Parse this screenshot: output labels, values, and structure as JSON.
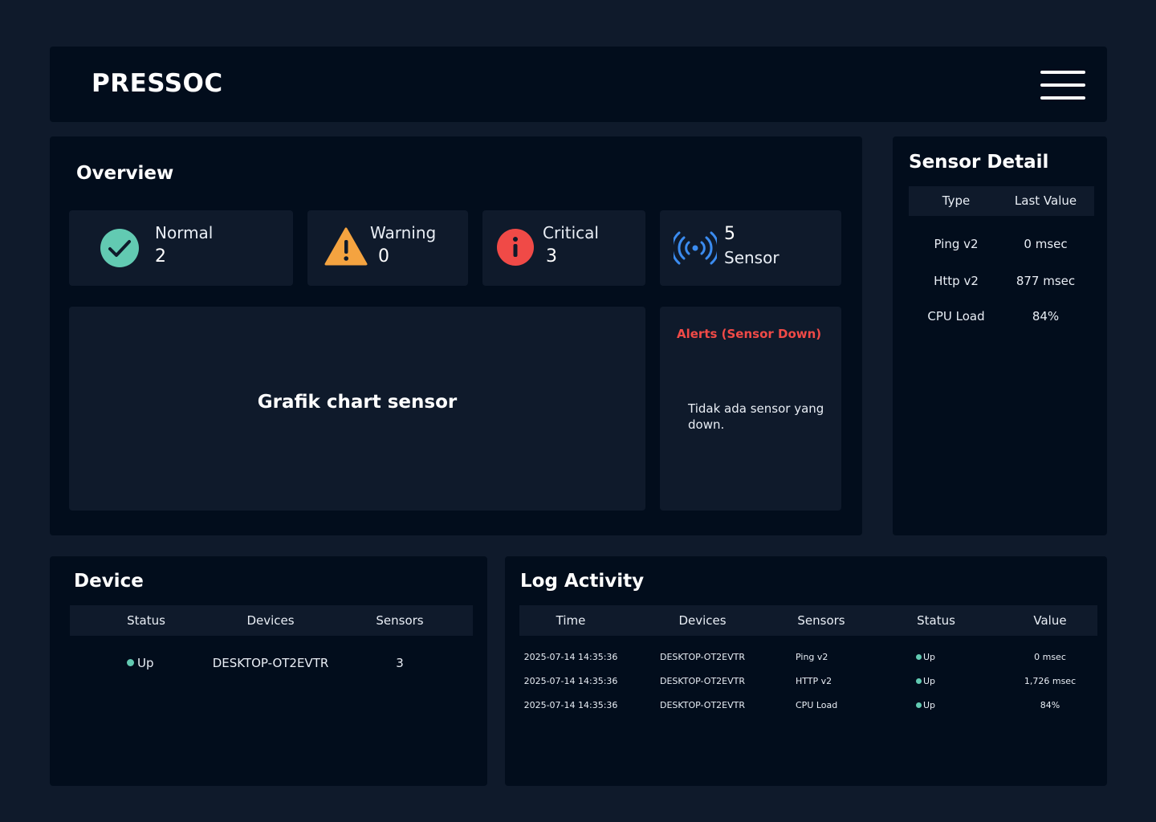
{
  "app": {
    "brand": "PRESSOC"
  },
  "overview": {
    "title": "Overview",
    "stats": [
      {
        "label": "Normal",
        "value": "2",
        "icon": "check-circle-icon",
        "color": "#62cab2"
      },
      {
        "label": "Warning",
        "value": "0",
        "icon": "warning-triangle-icon",
        "color": "#f4a340"
      },
      {
        "label": "Critical",
        "value": "3",
        "icon": "info-circle-icon",
        "color": "#f04a47"
      },
      {
        "label": "Sensor",
        "value": "5",
        "icon": "broadcast-icon",
        "color": "#3b8cf0"
      }
    ],
    "chart_placeholder": "Grafik chart sensor",
    "alerts": {
      "title": "Alerts (Sensor Down)",
      "message": "Tidak ada sensor yang down."
    }
  },
  "sensor_detail": {
    "title": "Sensor Detail",
    "columns": [
      "Type",
      "Last Value"
    ],
    "rows": [
      {
        "type": "Ping v2",
        "value": "0 msec"
      },
      {
        "type": "Http v2",
        "value": "877 msec"
      },
      {
        "type": "CPU Load",
        "value": "84%"
      }
    ]
  },
  "device": {
    "title": "Device",
    "columns": [
      "Status",
      "Devices",
      "Sensors"
    ],
    "rows": [
      {
        "status": "Up",
        "device": "DESKTOP-OT2EVTR",
        "sensors": "3"
      }
    ]
  },
  "log": {
    "title": "Log Activity",
    "columns": [
      "Time",
      "Devices",
      "Sensors",
      "Status",
      "Value"
    ],
    "rows": [
      {
        "time": "2025-07-14 14:35:36",
        "device": "DESKTOP-OT2EVTR",
        "sensor": "Ping v2",
        "status": "Up",
        "value": "0 msec"
      },
      {
        "time": "2025-07-14 14:35:36",
        "device": "DESKTOP-OT2EVTR",
        "sensor": "HTTP v2",
        "status": "Up",
        "value": "1,726 msec"
      },
      {
        "time": "2025-07-14 14:35:36",
        "device": "DESKTOP-OT2EVTR",
        "sensor": "CPU Load",
        "status": "Up",
        "value": "84%"
      }
    ]
  },
  "colors": {
    "status_up": "#62cab2",
    "alert": "#f04a47"
  }
}
